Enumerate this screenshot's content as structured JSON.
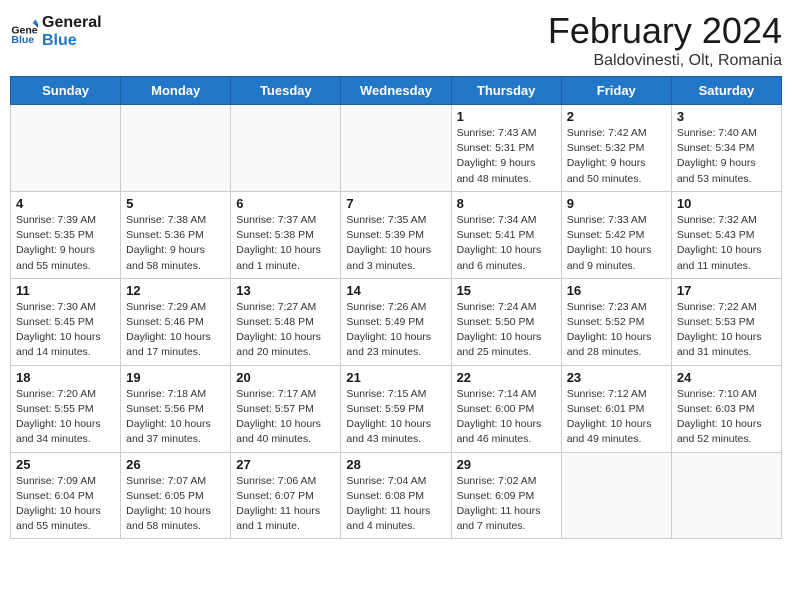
{
  "logo": {
    "line1": "General",
    "line2": "Blue"
  },
  "title": "February 2024",
  "subtitle": "Baldovinesti, Olt, Romania",
  "days_of_week": [
    "Sunday",
    "Monday",
    "Tuesday",
    "Wednesday",
    "Thursday",
    "Friday",
    "Saturday"
  ],
  "weeks": [
    [
      {
        "day": "",
        "info": ""
      },
      {
        "day": "",
        "info": ""
      },
      {
        "day": "",
        "info": ""
      },
      {
        "day": "",
        "info": ""
      },
      {
        "day": "1",
        "info": "Sunrise: 7:43 AM\nSunset: 5:31 PM\nDaylight: 9 hours\nand 48 minutes."
      },
      {
        "day": "2",
        "info": "Sunrise: 7:42 AM\nSunset: 5:32 PM\nDaylight: 9 hours\nand 50 minutes."
      },
      {
        "day": "3",
        "info": "Sunrise: 7:40 AM\nSunset: 5:34 PM\nDaylight: 9 hours\nand 53 minutes."
      }
    ],
    [
      {
        "day": "4",
        "info": "Sunrise: 7:39 AM\nSunset: 5:35 PM\nDaylight: 9 hours\nand 55 minutes."
      },
      {
        "day": "5",
        "info": "Sunrise: 7:38 AM\nSunset: 5:36 PM\nDaylight: 9 hours\nand 58 minutes."
      },
      {
        "day": "6",
        "info": "Sunrise: 7:37 AM\nSunset: 5:38 PM\nDaylight: 10 hours\nand 1 minute."
      },
      {
        "day": "7",
        "info": "Sunrise: 7:35 AM\nSunset: 5:39 PM\nDaylight: 10 hours\nand 3 minutes."
      },
      {
        "day": "8",
        "info": "Sunrise: 7:34 AM\nSunset: 5:41 PM\nDaylight: 10 hours\nand 6 minutes."
      },
      {
        "day": "9",
        "info": "Sunrise: 7:33 AM\nSunset: 5:42 PM\nDaylight: 10 hours\nand 9 minutes."
      },
      {
        "day": "10",
        "info": "Sunrise: 7:32 AM\nSunset: 5:43 PM\nDaylight: 10 hours\nand 11 minutes."
      }
    ],
    [
      {
        "day": "11",
        "info": "Sunrise: 7:30 AM\nSunset: 5:45 PM\nDaylight: 10 hours\nand 14 minutes."
      },
      {
        "day": "12",
        "info": "Sunrise: 7:29 AM\nSunset: 5:46 PM\nDaylight: 10 hours\nand 17 minutes."
      },
      {
        "day": "13",
        "info": "Sunrise: 7:27 AM\nSunset: 5:48 PM\nDaylight: 10 hours\nand 20 minutes."
      },
      {
        "day": "14",
        "info": "Sunrise: 7:26 AM\nSunset: 5:49 PM\nDaylight: 10 hours\nand 23 minutes."
      },
      {
        "day": "15",
        "info": "Sunrise: 7:24 AM\nSunset: 5:50 PM\nDaylight: 10 hours\nand 25 minutes."
      },
      {
        "day": "16",
        "info": "Sunrise: 7:23 AM\nSunset: 5:52 PM\nDaylight: 10 hours\nand 28 minutes."
      },
      {
        "day": "17",
        "info": "Sunrise: 7:22 AM\nSunset: 5:53 PM\nDaylight: 10 hours\nand 31 minutes."
      }
    ],
    [
      {
        "day": "18",
        "info": "Sunrise: 7:20 AM\nSunset: 5:55 PM\nDaylight: 10 hours\nand 34 minutes."
      },
      {
        "day": "19",
        "info": "Sunrise: 7:18 AM\nSunset: 5:56 PM\nDaylight: 10 hours\nand 37 minutes."
      },
      {
        "day": "20",
        "info": "Sunrise: 7:17 AM\nSunset: 5:57 PM\nDaylight: 10 hours\nand 40 minutes."
      },
      {
        "day": "21",
        "info": "Sunrise: 7:15 AM\nSunset: 5:59 PM\nDaylight: 10 hours\nand 43 minutes."
      },
      {
        "day": "22",
        "info": "Sunrise: 7:14 AM\nSunset: 6:00 PM\nDaylight: 10 hours\nand 46 minutes."
      },
      {
        "day": "23",
        "info": "Sunrise: 7:12 AM\nSunset: 6:01 PM\nDaylight: 10 hours\nand 49 minutes."
      },
      {
        "day": "24",
        "info": "Sunrise: 7:10 AM\nSunset: 6:03 PM\nDaylight: 10 hours\nand 52 minutes."
      }
    ],
    [
      {
        "day": "25",
        "info": "Sunrise: 7:09 AM\nSunset: 6:04 PM\nDaylight: 10 hours\nand 55 minutes."
      },
      {
        "day": "26",
        "info": "Sunrise: 7:07 AM\nSunset: 6:05 PM\nDaylight: 10 hours\nand 58 minutes."
      },
      {
        "day": "27",
        "info": "Sunrise: 7:06 AM\nSunset: 6:07 PM\nDaylight: 11 hours\nand 1 minute."
      },
      {
        "day": "28",
        "info": "Sunrise: 7:04 AM\nSunset: 6:08 PM\nDaylight: 11 hours\nand 4 minutes."
      },
      {
        "day": "29",
        "info": "Sunrise: 7:02 AM\nSunset: 6:09 PM\nDaylight: 11 hours\nand 7 minutes."
      },
      {
        "day": "",
        "info": ""
      },
      {
        "day": "",
        "info": ""
      }
    ]
  ]
}
